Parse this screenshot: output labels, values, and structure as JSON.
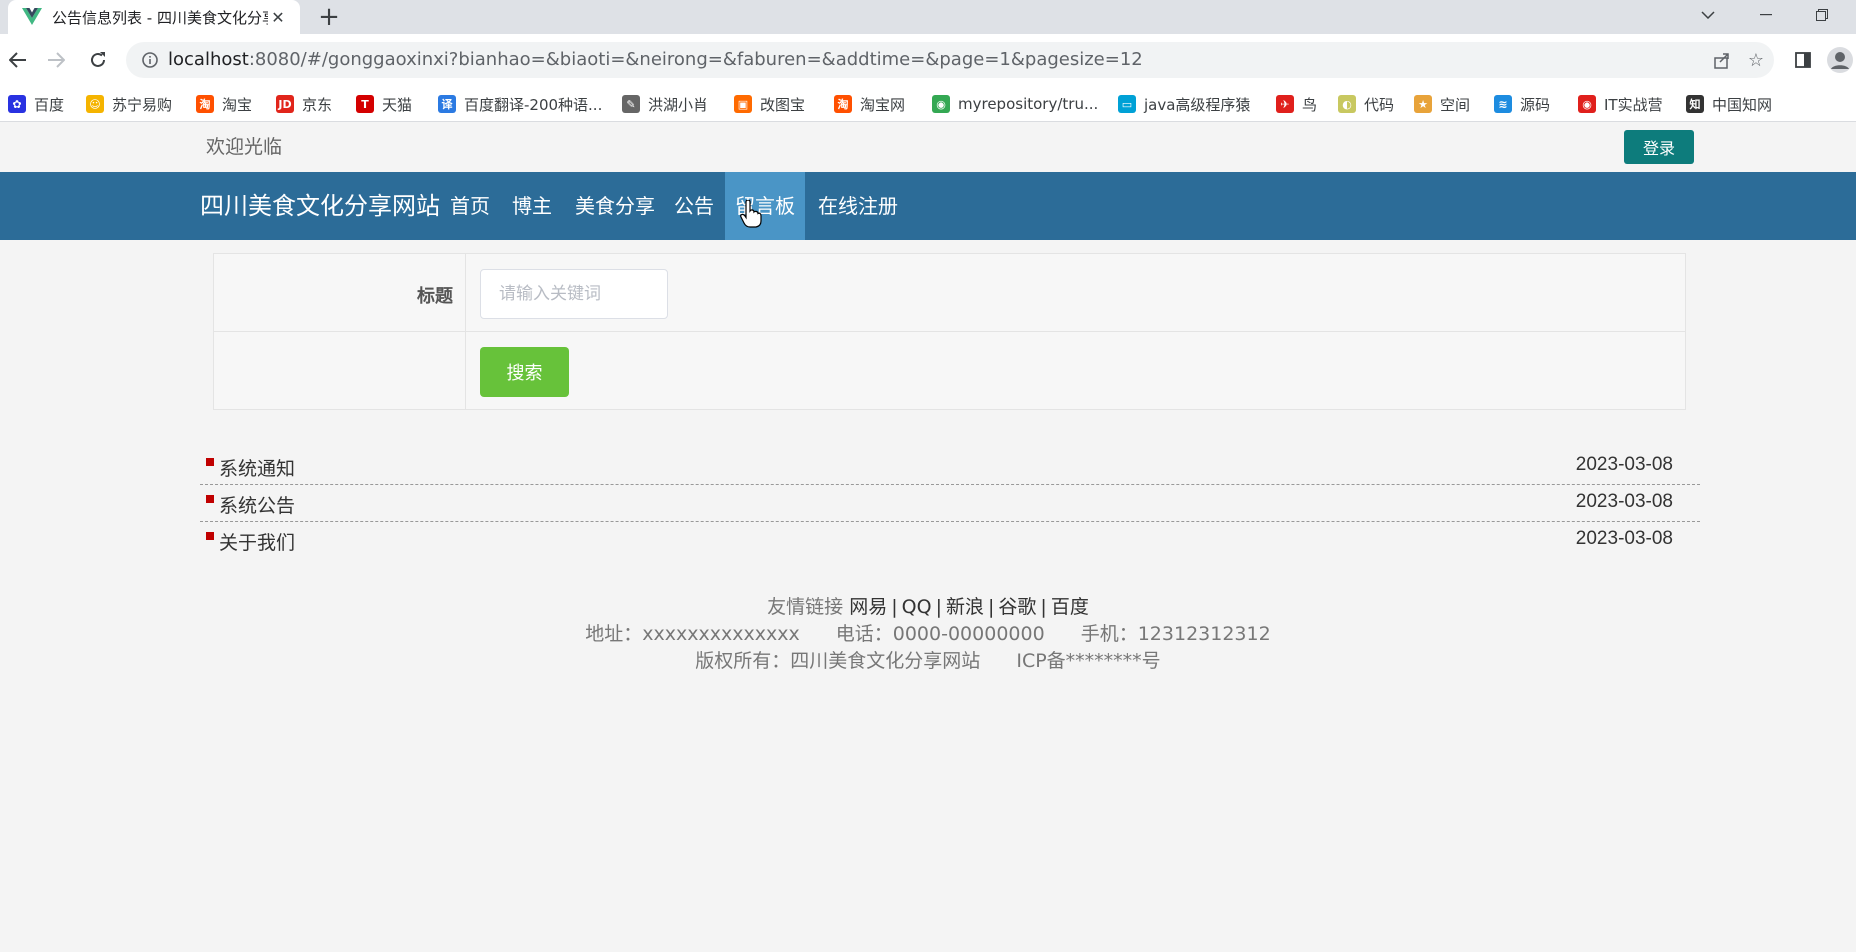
{
  "browser": {
    "tab_title": "公告信息列表 - 四川美食文化分享",
    "url_host": "localhost",
    "url_rest": ":8080/#/gonggaoxinxi?bianhao=&biaoti=&neirong=&faburen=&addtime=&page=1&pagesize=12",
    "bookmarks": [
      {
        "label": "百度",
        "color": "#2932e1",
        "icon": "paw-icon"
      },
      {
        "label": "苏宁易购",
        "color": "#f5b400",
        "icon": "lion-icon"
      },
      {
        "label": "淘宝",
        "color": "#ff5000",
        "icon": "taobao-icon"
      },
      {
        "label": "京东",
        "color": "#e1251b",
        "icon": "jd-icon"
      },
      {
        "label": "天猫",
        "color": "#d40000",
        "icon": "tmall-icon"
      },
      {
        "label": "百度翻译-200种语...",
        "color": "#2b7ae2",
        "icon": "translate-icon"
      },
      {
        "label": "洪湖小肖",
        "color": "#666666",
        "icon": "feather-icon"
      },
      {
        "label": "改图宝",
        "color": "#ff6a00",
        "icon": "image-icon"
      },
      {
        "label": "淘宝网",
        "color": "#ff5000",
        "icon": "taobao-icon"
      },
      {
        "label": "myrepository/tru...",
        "color": "#34a853",
        "icon": "chrome-icon"
      },
      {
        "label": "java高级程序猿",
        "color": "#00a1d6",
        "icon": "bilibili-icon"
      },
      {
        "label": "鸟",
        "color": "#e0201c",
        "icon": "bird-icon"
      },
      {
        "label": "代码",
        "color": "#c8c860",
        "icon": "code-icon"
      },
      {
        "label": "空间",
        "color": "#e8a33a",
        "icon": "qzone-icon"
      },
      {
        "label": "源码",
        "color": "#1d8ce0",
        "icon": "fish-icon"
      },
      {
        "label": "IT实战营",
        "color": "#e0201c",
        "icon": "chrome-red-icon"
      },
      {
        "label": "中国知网",
        "color": "#333333",
        "icon": "cnki-icon"
      }
    ]
  },
  "header": {
    "welcome": "欢迎光临",
    "login": "登录",
    "site_title": "四川美食文化分享网站",
    "nav": [
      "首页",
      "博主",
      "美食分享",
      "公告",
      "留言板",
      "在线注册"
    ]
  },
  "search": {
    "label": "标题",
    "placeholder": "请输入关键词",
    "button": "搜索"
  },
  "notices": [
    {
      "title": "系统通知",
      "date": "2023-03-08"
    },
    {
      "title": "系统公告",
      "date": "2023-03-08"
    },
    {
      "title": "关于我们",
      "date": "2023-03-08"
    }
  ],
  "footer": {
    "links_label": "友情链接",
    "links": [
      "网易",
      "QQ",
      "新浪",
      "谷歌",
      "百度"
    ],
    "address": "地址：xxxxxxxxxxxxxx",
    "phone": "电话：0000-00000000",
    "mobile": "手机：12312312312",
    "copyright": "版权所有：四川美食文化分享网站",
    "icp": "ICP备********号"
  },
  "colors": {
    "navbar": "#2c6c98",
    "nav_active": "#4a95c6",
    "login_button": "#0d7c7c",
    "search_button": "#67c23a",
    "bullet": "#c00000"
  }
}
